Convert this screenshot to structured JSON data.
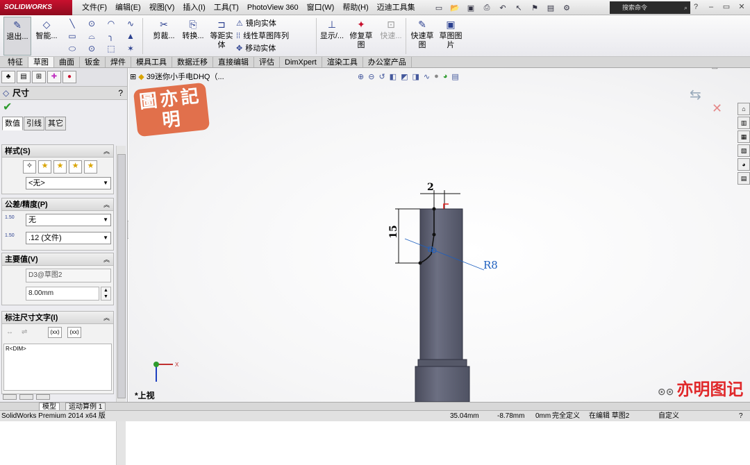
{
  "app": {
    "logo": "SOLIDWORKS"
  },
  "menu": [
    "文件(F)",
    "编辑(E)",
    "视图(V)",
    "插入(I)",
    "工具(T)",
    "PhotoView 360",
    "窗口(W)",
    "帮助(H)",
    "迈迪工具集"
  ],
  "search": {
    "placeholder": "搜索命令"
  },
  "ribbon": {
    "exit": "退出...",
    "smart": "智能...",
    "trim": "剪裁...",
    "convert": "转换...",
    "offset_a": "等距实",
    "offset_b": "体",
    "mirror": "镜向实体",
    "pattern": "线性草图阵列",
    "move": "移动实体",
    "display": "显示/...",
    "repair_a": "修复草",
    "repair_b": "图",
    "quick": "快速...",
    "quicksnap_a": "快速草",
    "quicksnap_b": "图",
    "picture_a": "草图图",
    "picture_b": "片"
  },
  "tabs": [
    "特征",
    "草图",
    "曲面",
    "钣金",
    "焊件",
    "模具工具",
    "数据迁移",
    "直接编辑",
    "评估",
    "DimXpert",
    "渲染工具",
    "办公室产品"
  ],
  "tabs_active": "草图",
  "panel": {
    "title": "尺寸",
    "help": "?",
    "subtabs": [
      "数值",
      "引线",
      "其它"
    ],
    "style": {
      "title": "样式(S)",
      "select": "<无>"
    },
    "tolerance": {
      "title": "公差/精度(P)",
      "tol_select": "无",
      "prec_select": ".12 (文件)",
      "tol_icon": "1.50",
      "prec_icon": "1.50"
    },
    "primary": {
      "title": "主要值(V)",
      "name": "D3@草图2",
      "value": "8.00mm"
    },
    "dimtext": {
      "title": "标注尺寸文字(I)",
      "text": "R<DIM>",
      "x1": "(xx)",
      "x2": "(xx)"
    }
  },
  "viewport": {
    "tree_label": "39迷你小手电DHQ（...",
    "stamp_text": "圖亦記明",
    "watermark": "亦明图记",
    "view_label": "*上视",
    "axis_x": "X",
    "dim_top": "2",
    "dim_left": "15",
    "dim_radius": "R8"
  },
  "bottom_tabs": [
    "模型",
    "运动算例 1"
  ],
  "status": {
    "version": "SolidWorks Premium 2014 x64 版",
    "x": "35.04mm",
    "y": "-8.78mm",
    "z": "0mm",
    "state": "完全定义",
    "editing": "在编辑 草图2",
    "custom": "自定义"
  },
  "colors": {
    "accent": "#c8102e",
    "part": "#5c5f72",
    "dim": "#1d5fbf",
    "watermark": "#e0292b"
  }
}
